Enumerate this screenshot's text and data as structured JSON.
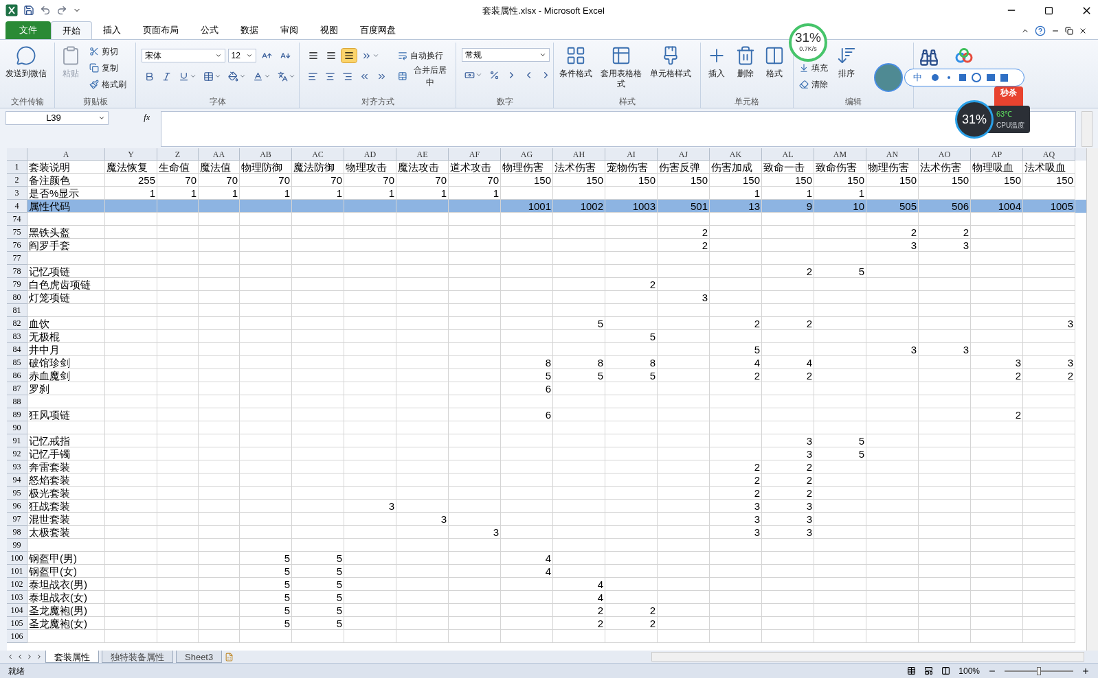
{
  "window": {
    "title": "套装属性.xlsx - Microsoft Excel"
  },
  "ribbon_tabs": [
    {
      "label": "文件",
      "kind": "file",
      "selected": false
    },
    {
      "label": "开始",
      "kind": "tab",
      "selected": true
    },
    {
      "label": "插入",
      "kind": "tab",
      "selected": false
    },
    {
      "label": "页面布局",
      "kind": "tab",
      "selected": false
    },
    {
      "label": "公式",
      "kind": "tab",
      "selected": false
    },
    {
      "label": "数据",
      "kind": "tab",
      "selected": false
    },
    {
      "label": "审阅",
      "kind": "tab",
      "selected": false
    },
    {
      "label": "视图",
      "kind": "tab",
      "selected": false
    },
    {
      "label": "百度网盘",
      "kind": "tab",
      "selected": false
    }
  ],
  "ribbon_groups": [
    {
      "label": "文件传输",
      "kind": "generic",
      "items": [
        {
          "kind": "large",
          "label": "发送到微信",
          "disabled": false
        }
      ]
    },
    {
      "label": "剪贴板",
      "kind": "generic",
      "items": [
        {
          "kind": "large",
          "label": "粘贴",
          "disabled": true
        },
        {
          "kind": "small",
          "label": "剪切",
          "disabled": false
        },
        {
          "kind": "small",
          "label": "复制",
          "disabled": false
        },
        {
          "kind": "small",
          "label": "格式刷",
          "disabled": false
        }
      ]
    },
    {
      "label": "字体",
      "kind": "font",
      "font": "宋体",
      "size": "12"
    },
    {
      "label": "对齐方式",
      "kind": "alignment",
      "vertical_align": [
        {
          "selected": false
        },
        {
          "selected": false
        },
        {
          "selected": true
        }
      ],
      "items": [
        {
          "label": "自动换行"
        },
        {
          "label": "合并后居中"
        }
      ]
    },
    {
      "label": "数字",
      "kind": "number",
      "format": "常规"
    },
    {
      "label": "样式",
      "kind": "generic",
      "items": [
        {
          "kind": "large",
          "label": "条件格式",
          "disabled": false
        },
        {
          "kind": "large",
          "label": "套用表格格式",
          "disabled": false
        },
        {
          "kind": "large",
          "label": "单元格样式",
          "disabled": false
        }
      ]
    },
    {
      "label": "单元格",
      "kind": "generic",
      "items": [
        {
          "kind": "large",
          "label": "插入",
          "disabled": false
        },
        {
          "kind": "large",
          "label": "删除",
          "disabled": false
        },
        {
          "kind": "large",
          "label": "格式",
          "disabled": false
        }
      ]
    },
    {
      "label": "编辑",
      "kind": "generic",
      "items": [
        {
          "kind": "small",
          "label": "填充",
          "disabled": false
        },
        {
          "kind": "small",
          "label": "清除",
          "disabled": false
        },
        {
          "kind": "large",
          "label": "排序",
          "disabled": false
        }
      ]
    }
  ],
  "formula_bar": {
    "name_box": "L39",
    "function_label": "fx"
  },
  "columns": [
    "A",
    "Y",
    "Z",
    "AA",
    "AB",
    "AC",
    "AD",
    "AE",
    "AF",
    "AG",
    "AH",
    "AI",
    "AJ",
    "AK",
    "AL",
    "AM",
    "AN",
    "AO",
    "AP",
    "AQ"
  ],
  "rows": [
    {
      "number": "1",
      "highlighted": false,
      "cells": [
        "套装说明",
        "魔法恢复",
        "生命值",
        "魔法值",
        "物理防御",
        "魔法防御",
        "物理攻击",
        "魔法攻击",
        "道术攻击",
        "物理伤害",
        "法术伤害",
        "宠物伤害",
        "伤害反弹",
        "伤害加成",
        "致命一击",
        "致命伤害",
        "物理伤害",
        "法术伤害",
        "物理吸血",
        "法术吸血"
      ]
    },
    {
      "number": "2",
      "highlighted": false,
      "cells": [
        "备注颜色",
        "255",
        "70",
        "70",
        "70",
        "70",
        "70",
        "70",
        "70",
        "150",
        "150",
        "150",
        "150",
        "150",
        "150",
        "150",
        "150",
        "150",
        "150",
        "150"
      ]
    },
    {
      "number": "3",
      "highlighted": false,
      "cells": [
        "是否%显示",
        "1",
        "1",
        "1",
        "1",
        "1",
        "1",
        "1",
        "1",
        null,
        null,
        null,
        null,
        "1",
        "1",
        "1",
        null,
        null,
        null,
        null
      ]
    },
    {
      "number": "4",
      "highlighted": true,
      "cells": [
        "属性代码",
        null,
        null,
        null,
        null,
        null,
        null,
        null,
        null,
        "1001",
        "1002",
        "1003",
        "501",
        "13",
        "9",
        "10",
        "505",
        "506",
        "1004",
        "1005"
      ]
    },
    {
      "number": "74",
      "highlighted": false,
      "cells": [
        null,
        null,
        null,
        null,
        null,
        null,
        null,
        null,
        null,
        null,
        null,
        null,
        null,
        null,
        null,
        null,
        null,
        null,
        null,
        null
      ]
    },
    {
      "number": "75",
      "highlighted": false,
      "cells": [
        "黑铁头盔",
        null,
        null,
        null,
        null,
        null,
        null,
        null,
        null,
        null,
        null,
        null,
        "2",
        null,
        null,
        null,
        "2",
        "2",
        null,
        null
      ]
    },
    {
      "number": "76",
      "highlighted": false,
      "cells": [
        "阎罗手套",
        null,
        null,
        null,
        null,
        null,
        null,
        null,
        null,
        null,
        null,
        null,
        "2",
        null,
        null,
        null,
        "3",
        "3",
        null,
        null
      ]
    },
    {
      "number": "77",
      "highlighted": false,
      "cells": [
        null,
        null,
        null,
        null,
        null,
        null,
        null,
        null,
        null,
        null,
        null,
        null,
        null,
        null,
        null,
        null,
        null,
        null,
        null,
        null
      ]
    },
    {
      "number": "78",
      "highlighted": false,
      "cells": [
        "记忆项链",
        null,
        null,
        null,
        null,
        null,
        null,
        null,
        null,
        null,
        null,
        null,
        null,
        null,
        "2",
        "5",
        null,
        null,
        null,
        null
      ]
    },
    {
      "number": "79",
      "highlighted": false,
      "cells": [
        "白色虎齿项链",
        null,
        null,
        null,
        null,
        null,
        null,
        null,
        null,
        null,
        null,
        "2",
        null,
        null,
        null,
        null,
        null,
        null,
        null,
        null
      ]
    },
    {
      "number": "80",
      "highlighted": false,
      "cells": [
        "灯笼项链",
        null,
        null,
        null,
        null,
        null,
        null,
        null,
        null,
        null,
        null,
        null,
        "3",
        null,
        null,
        null,
        null,
        null,
        null,
        null
      ]
    },
    {
      "number": "81",
      "highlighted": false,
      "cells": [
        null,
        null,
        null,
        null,
        null,
        null,
        null,
        null,
        null,
        null,
        null,
        null,
        null,
        null,
        null,
        null,
        null,
        null,
        null,
        null
      ]
    },
    {
      "number": "82",
      "highlighted": false,
      "cells": [
        "血饮",
        null,
        null,
        null,
        null,
        null,
        null,
        null,
        null,
        null,
        "5",
        null,
        null,
        "2",
        "2",
        null,
        null,
        null,
        null,
        "3"
      ]
    },
    {
      "number": "83",
      "highlighted": false,
      "cells": [
        "无极棍",
        null,
        null,
        null,
        null,
        null,
        null,
        null,
        null,
        null,
        null,
        "5",
        null,
        null,
        null,
        null,
        null,
        null,
        null,
        null
      ]
    },
    {
      "number": "84",
      "highlighted": false,
      "cells": [
        "井中月",
        null,
        null,
        null,
        null,
        null,
        null,
        null,
        null,
        null,
        null,
        null,
        null,
        "5",
        null,
        null,
        "3",
        "3",
        null,
        null
      ]
    },
    {
      "number": "85",
      "highlighted": false,
      "cells": [
        "破馆珍剑",
        null,
        null,
        null,
        null,
        null,
        null,
        null,
        null,
        "8",
        "8",
        "8",
        null,
        "4",
        "4",
        null,
        null,
        null,
        "3",
        "3"
      ]
    },
    {
      "number": "86",
      "highlighted": false,
      "cells": [
        "赤血魔剑",
        null,
        null,
        null,
        null,
        null,
        null,
        null,
        null,
        "5",
        "5",
        "5",
        null,
        "2",
        "2",
        null,
        null,
        null,
        "2",
        "2"
      ]
    },
    {
      "number": "87",
      "highlighted": false,
      "cells": [
        "罗刹",
        null,
        null,
        null,
        null,
        null,
        null,
        null,
        null,
        "6",
        null,
        null,
        null,
        null,
        null,
        null,
        null,
        null,
        null,
        null
      ]
    },
    {
      "number": "88",
      "highlighted": false,
      "cells": [
        null,
        null,
        null,
        null,
        null,
        null,
        null,
        null,
        null,
        null,
        null,
        null,
        null,
        null,
        null,
        null,
        null,
        null,
        null,
        null
      ]
    },
    {
      "number": "89",
      "highlighted": false,
      "cells": [
        "狂风项链",
        null,
        null,
        null,
        null,
        null,
        null,
        null,
        null,
        "6",
        null,
        null,
        null,
        null,
        null,
        null,
        null,
        null,
        "2",
        null
      ]
    },
    {
      "number": "90",
      "highlighted": false,
      "cells": [
        null,
        null,
        null,
        null,
        null,
        null,
        null,
        null,
        null,
        null,
        null,
        null,
        null,
        null,
        null,
        null,
        null,
        null,
        null,
        null
      ]
    },
    {
      "number": "91",
      "highlighted": false,
      "cells": [
        "记忆戒指",
        null,
        null,
        null,
        null,
        null,
        null,
        null,
        null,
        null,
        null,
        null,
        null,
        null,
        "3",
        "5",
        null,
        null,
        null,
        null
      ]
    },
    {
      "number": "92",
      "highlighted": false,
      "cells": [
        "记忆手镯",
        null,
        null,
        null,
        null,
        null,
        null,
        null,
        null,
        null,
        null,
        null,
        null,
        null,
        "3",
        "5",
        null,
        null,
        null,
        null
      ]
    },
    {
      "number": "93",
      "highlighted": false,
      "cells": [
        "奔雷套装",
        null,
        null,
        null,
        null,
        null,
        null,
        null,
        null,
        null,
        null,
        null,
        null,
        "2",
        "2",
        null,
        null,
        null,
        null,
        null
      ]
    },
    {
      "number": "94",
      "highlighted": false,
      "cells": [
        "怒焰套装",
        null,
        null,
        null,
        null,
        null,
        null,
        null,
        null,
        null,
        null,
        null,
        null,
        "2",
        "2",
        null,
        null,
        null,
        null,
        null
      ]
    },
    {
      "number": "95",
      "highlighted": false,
      "cells": [
        "极光套装",
        null,
        null,
        null,
        null,
        null,
        null,
        null,
        null,
        null,
        null,
        null,
        null,
        "2",
        "2",
        null,
        null,
        null,
        null,
        null
      ]
    },
    {
      "number": "96",
      "highlighted": false,
      "cells": [
        "狂战套装",
        null,
        null,
        null,
        null,
        null,
        "3",
        null,
        null,
        null,
        null,
        null,
        null,
        "3",
        "3",
        null,
        null,
        null,
        null,
        null
      ]
    },
    {
      "number": "97",
      "highlighted": false,
      "cells": [
        "混世套装",
        null,
        null,
        null,
        null,
        null,
        null,
        "3",
        null,
        null,
        null,
        null,
        null,
        "3",
        "3",
        null,
        null,
        null,
        null,
        null
      ]
    },
    {
      "number": "98",
      "highlighted": false,
      "cells": [
        "太极套装",
        null,
        null,
        null,
        null,
        null,
        null,
        null,
        "3",
        null,
        null,
        null,
        null,
        "3",
        "3",
        null,
        null,
        null,
        null,
        null
      ]
    },
    {
      "number": "99",
      "highlighted": false,
      "cells": [
        null,
        null,
        null,
        null,
        null,
        null,
        null,
        null,
        null,
        null,
        null,
        null,
        null,
        null,
        null,
        null,
        null,
        null,
        null,
        null
      ]
    },
    {
      "number": "100",
      "highlighted": false,
      "cells": [
        "钢盔甲(男)",
        null,
        null,
        null,
        "5",
        "5",
        null,
        null,
        null,
        "4",
        null,
        null,
        null,
        null,
        null,
        null,
        null,
        null,
        null,
        null
      ]
    },
    {
      "number": "101",
      "highlighted": false,
      "cells": [
        "钢盔甲(女)",
        null,
        null,
        null,
        "5",
        "5",
        null,
        null,
        null,
        "4",
        null,
        null,
        null,
        null,
        null,
        null,
        null,
        null,
        null,
        null
      ]
    },
    {
      "number": "102",
      "highlighted": false,
      "cells": [
        "泰坦战衣(男)",
        null,
        null,
        null,
        "5",
        "5",
        null,
        null,
        null,
        null,
        "4",
        null,
        null,
        null,
        null,
        null,
        null,
        null,
        null,
        null
      ]
    },
    {
      "number": "103",
      "highlighted": false,
      "cells": [
        "泰坦战衣(女)",
        null,
        null,
        null,
        "5",
        "5",
        null,
        null,
        null,
        null,
        "4",
        null,
        null,
        null,
        null,
        null,
        null,
        null,
        null,
        null
      ]
    },
    {
      "number": "104",
      "highlighted": false,
      "cells": [
        "圣龙魔袍(男)",
        null,
        null,
        null,
        "5",
        "5",
        null,
        null,
        null,
        null,
        "2",
        "2",
        null,
        null,
        null,
        null,
        null,
        null,
        null,
        null
      ]
    },
    {
      "number": "105",
      "highlighted": false,
      "cells": [
        "圣龙魔袍(女)",
        null,
        null,
        null,
        "5",
        "5",
        null,
        null,
        null,
        null,
        "2",
        "2",
        null,
        null,
        null,
        null,
        null,
        null,
        null,
        null
      ]
    },
    {
      "number": "106",
      "highlighted": false,
      "cells": [
        null,
        null,
        null,
        null,
        null,
        null,
        null,
        null,
        null,
        null,
        null,
        null,
        null,
        null,
        null,
        null,
        null,
        null,
        null,
        null
      ]
    }
  ],
  "sheet_tabs": [
    {
      "label": "套装属性",
      "selected": true
    },
    {
      "label": "独特装备属性",
      "selected": false
    },
    {
      "label": "Sheet3",
      "selected": false
    }
  ],
  "status_bar": {
    "status": "就绪",
    "zoom": "100%",
    "zoom_slider": {
      "level": 0.5
    }
  },
  "overlays": {
    "network_meter": {
      "percent": "31%",
      "speed": "0.7K/s"
    },
    "ime_bar": {
      "mode": "中"
    },
    "promo_badge": "秒杀",
    "cpu_meter": {
      "percent": "31%",
      "temperature": "63℃",
      "label": "CPU温度"
    }
  }
}
